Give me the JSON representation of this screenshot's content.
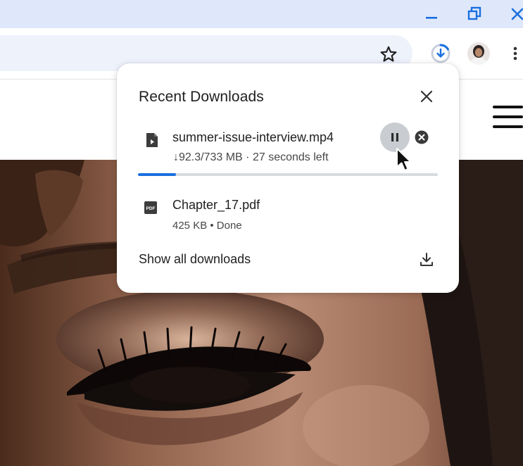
{
  "window": {
    "minimize_icon": "minimize-icon",
    "restore_icon": "restore-icon",
    "close_icon": "close-icon"
  },
  "toolbar": {
    "bookmark_icon": "star-icon",
    "download_indicator_icon": "download-progress-icon",
    "menu_icon": "kebab-menu-icon"
  },
  "downloads_popup": {
    "title": "Recent Downloads",
    "items": [
      {
        "name": "summer-issue-interview.mp4",
        "status_arrow": "↓",
        "status": "92.3/733 MB · 27 seconds left",
        "progress": 0.126,
        "icon": "video-file-icon"
      },
      {
        "name": "Chapter_17.pdf",
        "status": "425 KB • Done",
        "icon": "pdf-file-icon",
        "icon_label": "PDF"
      }
    ],
    "show_all_label": "Show all downloads"
  },
  "colors": {
    "titlebar": "#dfe8fa",
    "accent": "#1a6fe0",
    "omnibox": "#eef2fb"
  }
}
